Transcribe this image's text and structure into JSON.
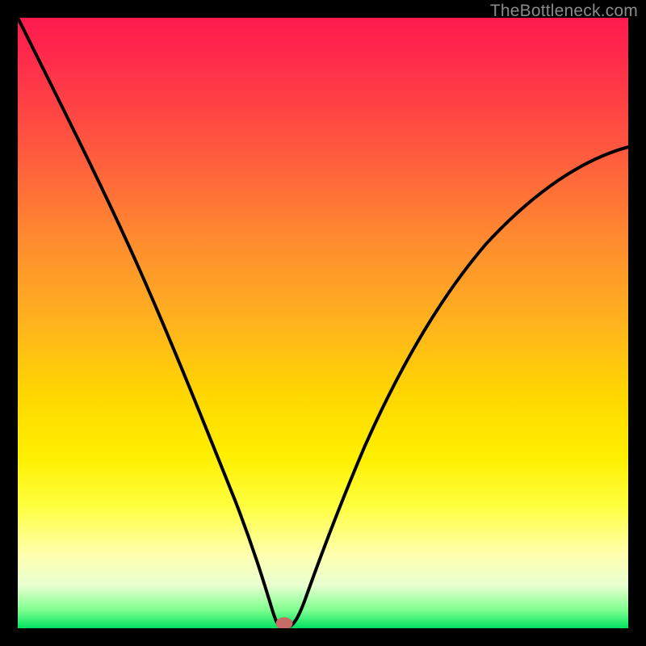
{
  "watermark": {
    "text": "TheBottleneck.com"
  },
  "chart_data": {
    "type": "line",
    "title": "",
    "xlabel": "",
    "ylabel": "",
    "xlim": [
      0,
      100
    ],
    "ylim": [
      0,
      100
    ],
    "grid": false,
    "legend": false,
    "series": [
      {
        "name": "bottleneck-curve",
        "x": [
          0,
          5,
          10,
          15,
          20,
          25,
          30,
          33,
          36,
          38,
          40,
          42,
          43,
          45,
          48,
          52,
          56,
          60,
          65,
          70,
          76,
          82,
          88,
          94,
          100
        ],
        "values": [
          100,
          90,
          80,
          70,
          59,
          47,
          34,
          25,
          16,
          10,
          4,
          1,
          0,
          1,
          6,
          14,
          23,
          32,
          42,
          50,
          57,
          63,
          68,
          71,
          74
        ]
      }
    ],
    "marker": {
      "x": 43,
      "y": 0,
      "color": "#c66a65"
    },
    "background_gradient": {
      "stops": [
        {
          "pos": 0,
          "color": "#ff1a4e"
        },
        {
          "pos": 50,
          "color": "#ffd700"
        },
        {
          "pos": 88,
          "color": "#ffffb0"
        },
        {
          "pos": 100,
          "color": "#00e060"
        }
      ]
    }
  }
}
